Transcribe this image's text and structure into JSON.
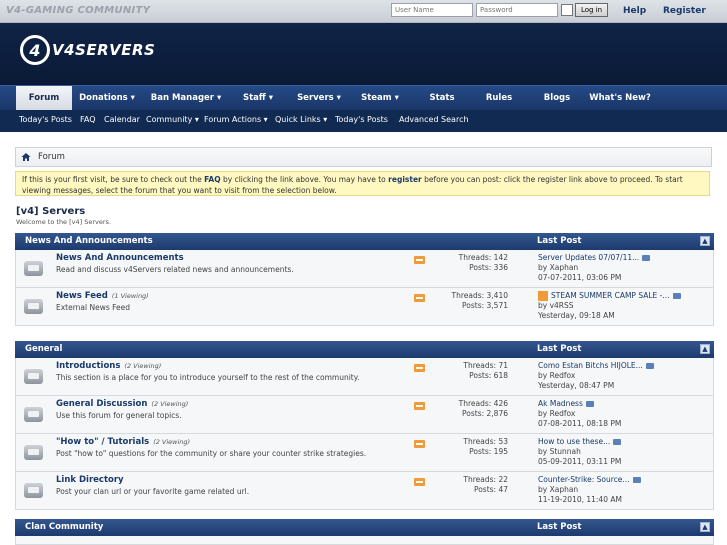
{
  "site_title": "V4-GAMING COMMUNITY",
  "login": {
    "username_placeholder": "User Name",
    "password_placeholder": "Password",
    "button": "Log in",
    "help": "Help",
    "register": "Register"
  },
  "logo_text": "V4SERVERS",
  "nav": {
    "tabs": [
      "Forum",
      "Donations ▾",
      "Ban Manager ▾",
      "Staff ▾",
      "Servers ▾",
      "Steam ▾",
      "Stats",
      "Rules",
      "Blogs",
      "What's New?"
    ]
  },
  "subnav": [
    "Today's Posts",
    "FAQ",
    "Calendar",
    "Community ▾",
    "Forum Actions ▾",
    "Quick Links ▾",
    "Today's Posts",
    "Advanced Search"
  ],
  "breadcrumb": "Forum",
  "notice": {
    "p1": "If this is your first visit, be sure to check out the ",
    "faq": "FAQ",
    "p2": " by clicking the link above. You may have to ",
    "register": "register",
    "p3": " before you can post: click the register link above to proceed. To start viewing messages, select the forum that you want to visit from the selection below."
  },
  "forum": {
    "title": "[v4] Servers",
    "desc": "Welcome to the [v4] Servers."
  },
  "categories": [
    {
      "name": "News And Announcements",
      "last_post_label": "Last Post",
      "forums": [
        {
          "name": "News And Announcements",
          "viewing": "",
          "desc": "Read and discuss v4Servers related news and announcements.",
          "threads": "Threads: 142",
          "posts": "Posts: 336",
          "lp_title": "Server Updates 07/07/11...",
          "lp_by": "by Xaphan",
          "lp_time": "07-07-2011, 03:06 PM"
        },
        {
          "name": "News Feed",
          "viewing": "(1 Viewing)",
          "desc": "External News Feed",
          "threads": "Threads: 3,410",
          "posts": "Posts: 3,571",
          "lp_title": "STEAM SUMMER CAMP SALE -...",
          "lp_by": "by v4RSS",
          "lp_time": "Yesterday, 09:18 AM"
        }
      ]
    },
    {
      "name": "General",
      "last_post_label": "Last Post",
      "forums": [
        {
          "name": "Introductions",
          "viewing": "(2 Viewing)",
          "desc": "This section is a place for you to introduce yourself to the rest of the community.",
          "threads": "Threads: 71",
          "posts": "Posts: 618",
          "lp_title": "Como Estan Bitchs HIJOLE...",
          "lp_by": "by Redfox",
          "lp_time": "Yesterday, 08:47 PM"
        },
        {
          "name": "General Discussion",
          "viewing": "(2 Viewing)",
          "desc": "Use this forum for general topics.",
          "threads": "Threads: 426",
          "posts": "Posts: 2,876",
          "lp_title": "Ak Madness",
          "lp_by": "by Redfox",
          "lp_time": "07-08-2011, 08:18 PM"
        },
        {
          "name": "\"How to\" / Tutorials",
          "viewing": "(2 Viewing)",
          "desc": "Post \"how to\" questions for the community or share your counter strike strategies.",
          "threads": "Threads: 53",
          "posts": "Posts: 195",
          "lp_title": "How to use these...",
          "lp_by": "by Stunnah",
          "lp_time": "05-09-2011, 03:11 PM"
        },
        {
          "name": "Link Directory",
          "viewing": "",
          "desc": "Post your clan url or your favorite game related url.",
          "threads": "Threads: 22",
          "posts": "Posts: 47",
          "lp_title": "Counter-Strike: Source...",
          "lp_by": "by Xaphan",
          "lp_time": "11-19-2010, 11:40 AM"
        }
      ]
    },
    {
      "name": "Clan Community",
      "last_post_label": "Last Post",
      "forums": []
    }
  ]
}
